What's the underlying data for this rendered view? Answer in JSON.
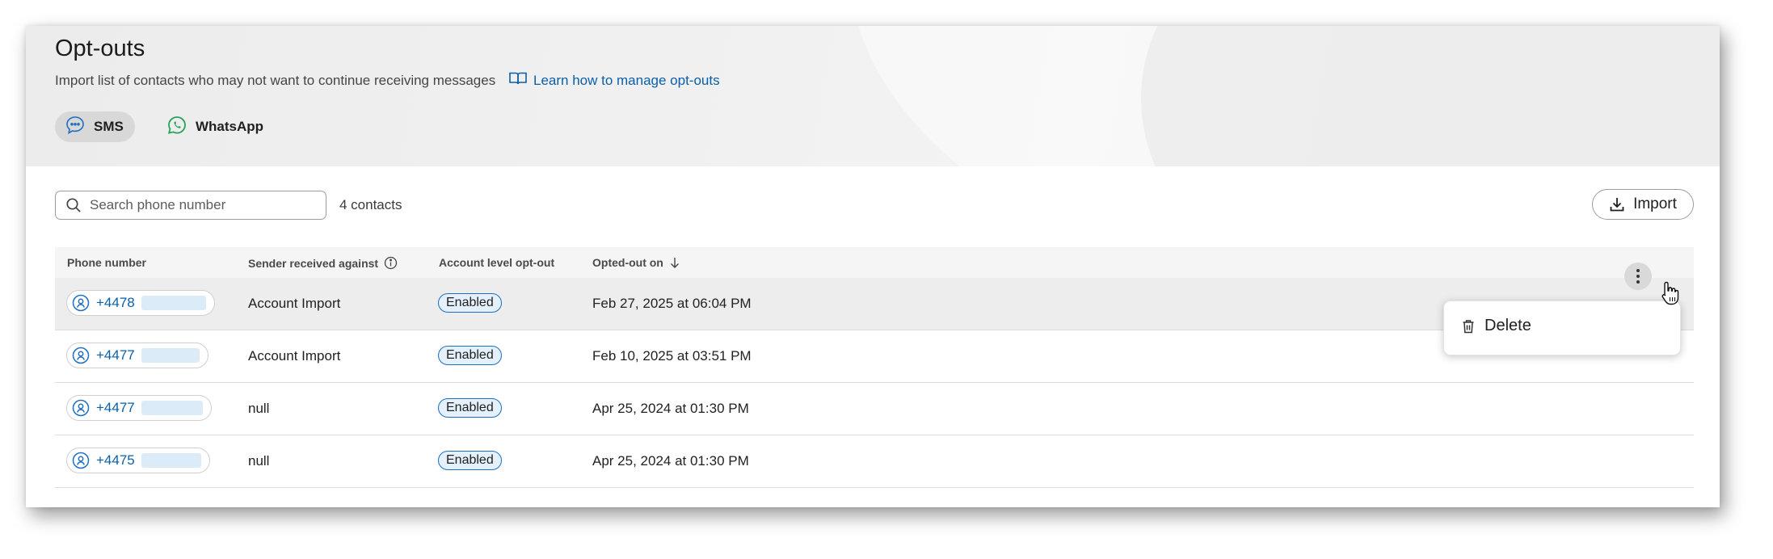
{
  "header": {
    "title": "Opt-outs",
    "subtitle": "Import list of contacts who may not want to continue receiving messages",
    "learn_link": "Learn how to manage opt-outs"
  },
  "channels": [
    {
      "label": "SMS",
      "selected": true,
      "icon": "chat-bubble-icon"
    },
    {
      "label": "WhatsApp",
      "selected": false,
      "icon": "whatsapp-icon"
    }
  ],
  "toolbar": {
    "search_placeholder": "Search phone number",
    "count": "4 contacts",
    "import_label": "Import"
  },
  "table": {
    "columns": [
      "Phone number",
      "Sender received against",
      "Account level opt-out",
      "Opted-out on"
    ],
    "rows": [
      {
        "phone": "+4478",
        "sender": "Account Import",
        "status": "Enabled",
        "date": "Feb 27, 2025 at 06:04 PM"
      },
      {
        "phone": "+4477",
        "sender": "Account Import",
        "status": "Enabled",
        "date": "Feb 10, 2025 at 03:51 PM"
      },
      {
        "phone": "+4477",
        "sender": "null",
        "status": "Enabled",
        "date": "Apr 25, 2024 at 01:30 PM"
      },
      {
        "phone": "+4475",
        "sender": "null",
        "status": "Enabled",
        "date": "Apr 25, 2024 at 01:30 PM"
      }
    ]
  },
  "row_menu": {
    "delete_label": "Delete"
  },
  "colors": {
    "link": "#0a5fa8",
    "badge_border": "#1e6fbf",
    "badge_bg": "#e4f0fb",
    "whatsapp": "#25a25a"
  }
}
